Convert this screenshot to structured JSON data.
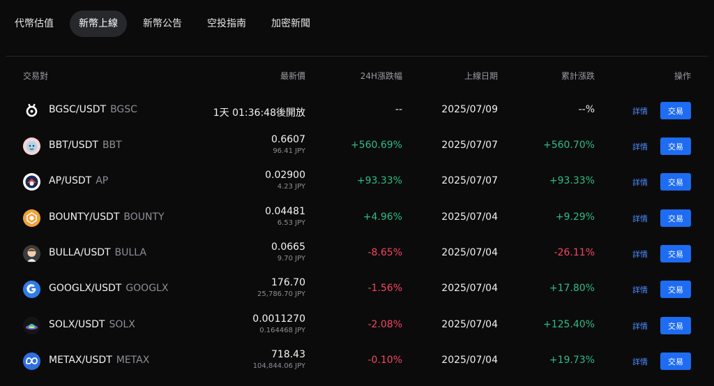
{
  "tabs": [
    {
      "label": "代幣估值",
      "active": false
    },
    {
      "label": "新幣上線",
      "active": true
    },
    {
      "label": "新幣公告",
      "active": false
    },
    {
      "label": "空投指南",
      "active": false
    },
    {
      "label": "加密新聞",
      "active": false
    }
  ],
  "table": {
    "headers": {
      "pair": "交易對",
      "price": "最新價",
      "change": "24H漲跌幅",
      "date": "上線日期",
      "cumulative": "累計漲跌",
      "action": "操作"
    },
    "detail_label": "詳情",
    "trade_label": "交易",
    "rows": [
      {
        "pair": "BGSC/USDT",
        "base": "BGSC",
        "price": "1天 01:36:48後開放",
        "jpy": "",
        "change": "--",
        "change_dir": "neutral",
        "date": "2025/07/09",
        "cumulative": "--%",
        "cum_dir": "neutral",
        "icon": "bgsc-icon"
      },
      {
        "pair": "BBT/USDT",
        "base": "BBT",
        "price": "0.6607",
        "jpy": "96.41 JPY",
        "change": "+560.69%",
        "change_dir": "up",
        "date": "2025/07/07",
        "cumulative": "+560.70%",
        "cum_dir": "up",
        "icon": "bbt-icon"
      },
      {
        "pair": "AP/USDT",
        "base": "AP",
        "price": "0.02900",
        "jpy": "4.23 JPY",
        "change": "+93.33%",
        "change_dir": "up",
        "date": "2025/07/07",
        "cumulative": "+93.33%",
        "cum_dir": "up",
        "icon": "ap-icon"
      },
      {
        "pair": "BOUNTY/USDT",
        "base": "BOUNTY",
        "price": "0.04481",
        "jpy": "6.53 JPY",
        "change": "+4.96%",
        "change_dir": "up",
        "date": "2025/07/04",
        "cumulative": "+9.29%",
        "cum_dir": "up",
        "icon": "bounty-icon"
      },
      {
        "pair": "BULLA/USDT",
        "base": "BULLA",
        "price": "0.0665",
        "jpy": "9.70 JPY",
        "change": "-8.65%",
        "change_dir": "down",
        "date": "2025/07/04",
        "cumulative": "-26.11%",
        "cum_dir": "down",
        "icon": "bulla-icon"
      },
      {
        "pair": "GOOGLX/USDT",
        "base": "GOOGLX",
        "price": "176.70",
        "jpy": "25,786.70 JPY",
        "change": "-1.56%",
        "change_dir": "down",
        "date": "2025/07/04",
        "cumulative": "+17.80%",
        "cum_dir": "up",
        "icon": "googlx-icon"
      },
      {
        "pair": "SOLX/USDT",
        "base": "SOLX",
        "price": "0.0011270",
        "jpy": "0.164468 JPY",
        "change": "-2.08%",
        "change_dir": "down",
        "date": "2025/07/04",
        "cumulative": "+125.40%",
        "cum_dir": "up",
        "icon": "solx-icon"
      },
      {
        "pair": "METAX/USDT",
        "base": "METAX",
        "price": "718.43",
        "jpy": "104,844.06 JPY",
        "change": "-0.10%",
        "change_dir": "down",
        "date": "2025/07/04",
        "cumulative": "+19.73%",
        "cum_dir": "up",
        "icon": "metax-icon"
      }
    ]
  },
  "colors": {
    "up": "#2ebd85",
    "down": "#f6465d",
    "accent": "#1e6cf2",
    "background": "#0b0b0c"
  }
}
